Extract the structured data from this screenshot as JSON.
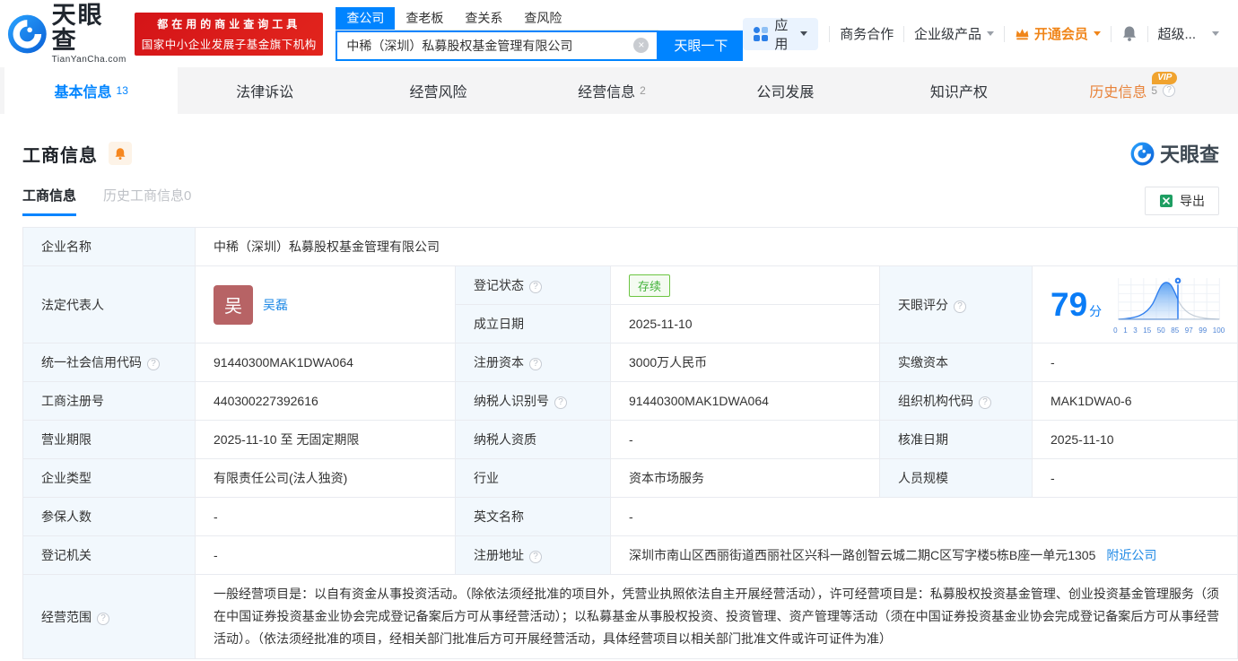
{
  "header": {
    "logo": {
      "title": "天眼查",
      "domain": "TianYanCha.com"
    },
    "banner": {
      "line1": "都在用的商业查询工具",
      "line2": "国家中小企业发展子基金旗下机构"
    },
    "search": {
      "tabs": [
        {
          "label": "查公司",
          "active": true
        },
        {
          "label": "查老板",
          "active": false
        },
        {
          "label": "查关系",
          "active": false
        },
        {
          "label": "查风险",
          "active": false
        }
      ],
      "value": "中稀（深圳）私募股权基金管理有限公司",
      "button": "天眼一下"
    },
    "nav": {
      "apps": "应用",
      "biz": "商务合作",
      "enterprise": "企业级产品",
      "vip": "开通会员",
      "more": "超级..."
    }
  },
  "tabs": [
    {
      "label": "基本信息",
      "count": "13"
    },
    {
      "label": "法律诉讼",
      "count": ""
    },
    {
      "label": "经营风险",
      "count": ""
    },
    {
      "label": "经营信息",
      "count": "2"
    },
    {
      "label": "公司发展",
      "count": ""
    },
    {
      "label": "知识产权",
      "count": ""
    },
    {
      "label": "历史信息",
      "count": "5",
      "vip": "VIP"
    }
  ],
  "section": {
    "title": "工商信息",
    "watermark": "天眼查",
    "subtabs": [
      {
        "label": "工商信息"
      },
      {
        "label": "历史工商信息",
        "count": "0"
      }
    ],
    "export_label": "导出"
  },
  "company": {
    "name_label": "企业名称",
    "name": "中稀（深圳）私募股权基金管理有限公司",
    "legal_rep_label": "法定代表人",
    "legal_rep_avatar": "吴",
    "legal_rep": "吴磊",
    "reg_status_label": "登记状态",
    "reg_status": "存续",
    "est_date_label": "成立日期",
    "est_date": "2025-11-10",
    "score_label": "天眼评分",
    "uscc_label": "统一社会信用代码",
    "uscc": "91440300MAK1DWA064",
    "reg_capital_label": "注册资本",
    "reg_capital": "3000万人民币",
    "paid_capital_label": "实缴资本",
    "paid_capital": "-",
    "reg_no_label": "工商注册号",
    "reg_no": "440300227392616",
    "taxpayer_id_label": "纳税人识别号",
    "taxpayer_id": "91440300MAK1DWA064",
    "org_code_label": "组织机构代码",
    "org_code": "MAK1DWA0-6",
    "biz_term_label": "营业期限",
    "biz_term": "2025-11-10 至 无固定期限",
    "taxpayer_qual_label": "纳税人资质",
    "taxpayer_qual": "-",
    "approval_date_label": "核准日期",
    "approval_date": "2025-11-10",
    "company_type_label": "企业类型",
    "company_type": "有限责任公司(法人独资)",
    "industry_label": "行业",
    "industry": "资本市场服务",
    "staff_size_label": "人员规模",
    "staff_size": "-",
    "insured_label": "参保人数",
    "insured": "-",
    "en_name_label": "英文名称",
    "en_name": "-",
    "reg_authority_label": "登记机关",
    "reg_authority": "-",
    "address_label": "注册地址",
    "address": "深圳市南山区西丽街道西丽社区兴科一路创智云城二期C区写字楼5栋B座一单元1305",
    "nearby": "附近公司",
    "scope_label": "经营范围",
    "scope": "一般经营项目是：以自有资金从事投资活动。（除依法须经批准的项目外，凭营业执照依法自主开展经营活动），许可经营项目是：私募股权投资基金管理、创业投资基金管理服务（须在中国证券投资基金业协会完成登记备案后方可从事经营活动）；以私募基金从事股权投资、投资管理、资产管理等活动（须在中国证券投资基金业协会完成登记备案后方可从事经营活动）。（依法须经批准的项目，经相关部门批准后方可开展经营活动，具体经营项目以相关部门批准文件或许可证件为准）"
  },
  "tianyan_score": {
    "value": "79",
    "unit": "分",
    "axis": [
      "0",
      "1",
      "3",
      "15",
      "50",
      "85",
      "97",
      "99",
      "100"
    ],
    "accent_color": "#0a7cf6"
  }
}
